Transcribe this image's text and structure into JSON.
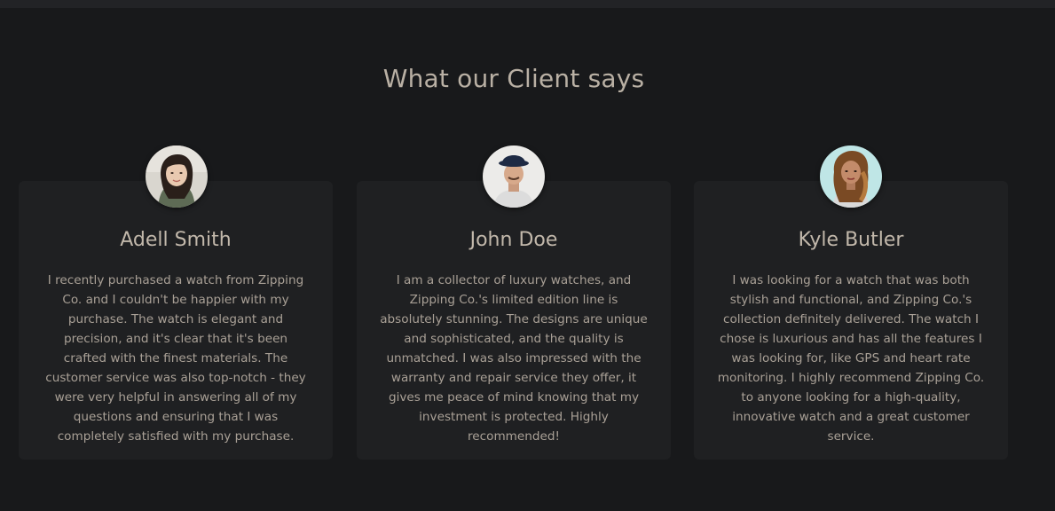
{
  "section": {
    "title": "What our Client says"
  },
  "testimonials": [
    {
      "name": "Adell Smith",
      "text": "I recently purchased a watch from Zipping Co. and I couldn't be happier with my purchase. The watch is elegant and precision, and it's clear that it's been crafted with the finest materials. The customer service was also top-notch - they were very helpful in answering all of my questions and ensuring that I was completely satisfied with my purchase."
    },
    {
      "name": "John Doe",
      "text": "I am a collector of luxury watches, and Zipping Co.'s limited edition line is absolutely stunning. The designs are unique and sophisticated, and the quality is unmatched. I was also impressed with the warranty and repair service they offer, it gives me peace of mind knowing that my investment is protected. Highly recommended!"
    },
    {
      "name": "Kyle Butler",
      "text": "I was looking for a watch that was both stylish and functional, and Zipping Co.'s collection definitely delivered. The watch I chose is luxurious and has all the features I was looking for, like GPS and heart rate monitoring. I highly recommend Zipping Co. to anyone looking for a high-quality, innovative watch and a great customer service."
    }
  ],
  "colors": {
    "background": "#18191b",
    "card": "#1f2022",
    "heading": "#b9b0a4",
    "body_text": "#a9a096"
  }
}
